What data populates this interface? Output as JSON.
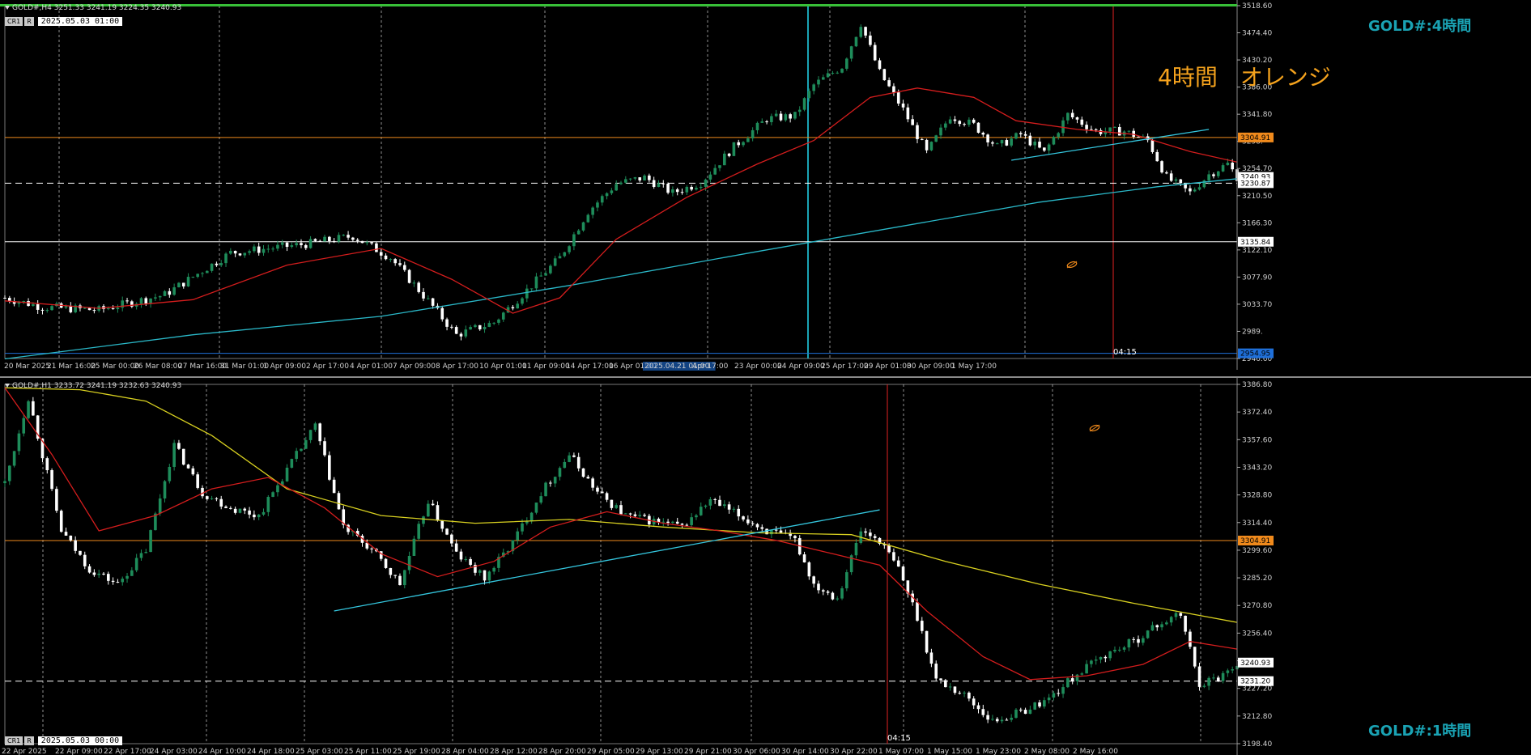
{
  "colors": {
    "bull": "#1e8c5a",
    "bear": "#ffffff",
    "ma_short": "#d41d1d",
    "ma_long_h4": "#2ab8c8",
    "ma_long_h1": "#d8d020",
    "resistance": "#f08a1c",
    "support": "#ffffff",
    "grid": "#cfcfcf",
    "trend": "#34c6de",
    "vline_red": "#e22222",
    "vline_cyan": "#1aa3b4",
    "bottom_blue": "#1f6fd8",
    "axis_text": "#d0d0d0"
  },
  "top_pane": {
    "header": "GOLD#,H4  3251.33 3241.19 3224.35 3240.93",
    "cr": "CR1",
    "r": "R",
    "datetime": "2025.05.03 01:00",
    "tf_label": "GOLD#:4時間",
    "note": "4時間　オレンジ",
    "time_tag": "04:15",
    "x_labels": [
      "20 Mar 2025",
      "21 Mar 16:00",
      "25 Mar 00:00",
      "26 Mar 08:00",
      "27 Mar 16:00",
      "31 Mar 01:00",
      "1 Apr 09:00",
      "2 Apr 17:00",
      "4 Apr 01:00",
      "7 Apr 09:00",
      "8 Apr 17:00",
      "10 Apr 01:00",
      "11 Apr 09:00",
      "14 Apr 17:00",
      "16 Apr 01:00",
      "2025.04.21 01:00",
      "Apr 17:00",
      "23 Apr 00:00",
      "24 Apr 09:00",
      "25 Apr 17:00",
      "29 Apr 01:00",
      "30 Apr 09:00",
      "1 May 17:00"
    ],
    "y_labels": [
      "3518.60",
      "3474.40",
      "3430.20",
      "3386.00",
      "3341.80",
      "3298.",
      "3254.70",
      "3210.50",
      "3166.30",
      "3122.10",
      "3077.90",
      "3033.70",
      "2989.",
      "2946.60"
    ],
    "price_tags": [
      {
        "text": "3304.91",
        "kind": "orange"
      },
      {
        "text": "3240.93",
        "kind": "white"
      },
      {
        "text": "3230.87",
        "kind": "white"
      },
      {
        "text": "3135.84",
        "kind": "white"
      },
      {
        "text": "2954.95",
        "kind": "blue"
      }
    ]
  },
  "bottom_pane": {
    "header": "GOLD#,H1  3233.72 3241.19 3232.63 3240.93",
    "cr": "CR1",
    "r": "R",
    "datetime": "2025.05.03 00:00",
    "tf_label": "GOLD#:1時間",
    "time_tag": "04:15",
    "x_labels": [
      "22 Apr 2025",
      "22 Apr 09:00",
      "22 Apr 17:00",
      "24 Apr 03:00",
      "24 Apr 10:00",
      "24 Apr 18:00",
      "25 Apr 03:00",
      "25 Apr 11:00",
      "25 Apr 19:00",
      "28 Apr 04:00",
      "28 Apr 12:00",
      "28 Apr 20:00",
      "29 Apr 05:00",
      "29 Apr 13:00",
      "29 Apr 21:00",
      "30 Apr 06:00",
      "30 Apr 14:00",
      "30 Apr 22:00",
      "1 May 07:00",
      "1 May 15:00",
      "1 May 23:00",
      "2 May 08:00",
      "2 May 16:00"
    ],
    "y_labels": [
      "3386.80",
      "3372.40",
      "3357.60",
      "3343.20",
      "3328.80",
      "3314.40",
      "3299.60",
      "3285.20",
      "3270.80",
      "3256.40",
      "3241.60",
      "3227.20",
      "3212.80",
      "3198.40"
    ],
    "price_tags": [
      {
        "text": "3304.91",
        "kind": "orange"
      },
      {
        "text": "3240.93",
        "kind": "white"
      },
      {
        "text": "3231.20",
        "kind": "white"
      }
    ]
  },
  "chart_data": [
    {
      "type": "candlestick",
      "symbol": "GOLD#",
      "timeframe": "H4",
      "title": "GOLD#:4時間",
      "ylim": [
        2946.6,
        3518.6
      ],
      "horizontal_levels": [
        {
          "price": 3304.91,
          "color": "orange"
        },
        {
          "price": 3230.87,
          "color": "white",
          "style": "dashed"
        },
        {
          "price": 3135.84,
          "color": "white"
        },
        {
          "price": 2954.95,
          "color": "blue"
        }
      ],
      "anchors": [
        {
          "idx": 0,
          "p": 3045
        },
        {
          "idx": 8,
          "p": 3030
        },
        {
          "idx": 20,
          "p": 3025
        },
        {
          "idx": 34,
          "p": 3050
        },
        {
          "idx": 48,
          "p": 3118
        },
        {
          "idx": 64,
          "p": 3132
        },
        {
          "idx": 74,
          "p": 3145
        },
        {
          "idx": 82,
          "p": 3110
        },
        {
          "idx": 90,
          "p": 3040
        },
        {
          "idx": 96,
          "p": 2985
        },
        {
          "idx": 104,
          "p": 3005
        },
        {
          "idx": 110,
          "p": 3050
        },
        {
          "idx": 118,
          "p": 3110
        },
        {
          "idx": 124,
          "p": 3185
        },
        {
          "idx": 130,
          "p": 3230
        },
        {
          "idx": 136,
          "p": 3240
        },
        {
          "idx": 142,
          "p": 3215
        },
        {
          "idx": 148,
          "p": 3232
        },
        {
          "idx": 155,
          "p": 3290
        },
        {
          "idx": 162,
          "p": 3335
        },
        {
          "idx": 168,
          "p": 3340
        },
        {
          "idx": 172,
          "p": 3390
        },
        {
          "idx": 178,
          "p": 3420
        },
        {
          "idx": 182,
          "p": 3490
        },
        {
          "idx": 186,
          "p": 3410
        },
        {
          "idx": 191,
          "p": 3350
        },
        {
          "idx": 196,
          "p": 3280
        },
        {
          "idx": 201,
          "p": 3340
        },
        {
          "idx": 206,
          "p": 3325
        },
        {
          "idx": 211,
          "p": 3290
        },
        {
          "idx": 216,
          "p": 3310
        },
        {
          "idx": 221,
          "p": 3280
        },
        {
          "idx": 226,
          "p": 3342
        },
        {
          "idx": 232,
          "p": 3315
        },
        {
          "idx": 238,
          "p": 3315
        },
        {
          "idx": 243,
          "p": 3300
        },
        {
          "idx": 247,
          "p": 3240
        },
        {
          "idx": 252,
          "p": 3215
        },
        {
          "idx": 256,
          "p": 3245
        },
        {
          "idx": 260,
          "p": 3262
        },
        {
          "idx": 262,
          "p": 3241
        }
      ],
      "ma_fast": [
        [
          0,
          3040
        ],
        [
          20,
          3028
        ],
        [
          40,
          3042
        ],
        [
          60,
          3098
        ],
        [
          80,
          3125
        ],
        [
          95,
          3075
        ],
        [
          108,
          3020
        ],
        [
          118,
          3045
        ],
        [
          130,
          3140
        ],
        [
          145,
          3208
        ],
        [
          160,
          3262
        ],
        [
          172,
          3300
        ],
        [
          184,
          3370
        ],
        [
          194,
          3385
        ],
        [
          206,
          3370
        ],
        [
          215,
          3332
        ],
        [
          228,
          3318
        ],
        [
          240,
          3310
        ],
        [
          252,
          3282
        ],
        [
          262,
          3265
        ]
      ],
      "ma_slow": [
        [
          0,
          2946
        ],
        [
          40,
          2985
        ],
        [
          80,
          3015
        ],
        [
          120,
          3065
        ],
        [
          160,
          3120
        ],
        [
          190,
          3160
        ],
        [
          220,
          3200
        ],
        [
          245,
          3225
        ],
        [
          262,
          3238
        ]
      ],
      "trendline": [
        [
          214,
          3268
        ],
        [
          256,
          3318
        ]
      ]
    },
    {
      "type": "candlestick",
      "symbol": "GOLD#",
      "timeframe": "H1",
      "title": "GOLD#:1時間",
      "ylim": [
        3198.4,
        3386.8
      ],
      "horizontal_levels": [
        {
          "price": 3304.91,
          "color": "orange"
        },
        {
          "price": 3231.2,
          "color": "white",
          "style": "dashed"
        }
      ],
      "anchors": [
        {
          "idx": 0,
          "p": 3335
        },
        {
          "idx": 5,
          "p": 3380
        },
        {
          "idx": 12,
          "p": 3310
        },
        {
          "idx": 18,
          "p": 3290
        },
        {
          "idx": 24,
          "p": 3282
        },
        {
          "idx": 30,
          "p": 3300
        },
        {
          "idx": 36,
          "p": 3355
        },
        {
          "idx": 42,
          "p": 3330
        },
        {
          "idx": 48,
          "p": 3322
        },
        {
          "idx": 54,
          "p": 3318
        },
        {
          "idx": 60,
          "p": 3342
        },
        {
          "idx": 66,
          "p": 3365
        },
        {
          "idx": 72,
          "p": 3312
        },
        {
          "idx": 78,
          "p": 3300
        },
        {
          "idx": 84,
          "p": 3282
        },
        {
          "idx": 90,
          "p": 3326
        },
        {
          "idx": 96,
          "p": 3298
        },
        {
          "idx": 102,
          "p": 3285
        },
        {
          "idx": 108,
          "p": 3304
        },
        {
          "idx": 114,
          "p": 3330
        },
        {
          "idx": 120,
          "p": 3350
        },
        {
          "idx": 126,
          "p": 3330
        },
        {
          "idx": 132,
          "p": 3318
        },
        {
          "idx": 138,
          "p": 3315
        },
        {
          "idx": 144,
          "p": 3312
        },
        {
          "idx": 150,
          "p": 3326
        },
        {
          "idx": 156,
          "p": 3318
        },
        {
          "idx": 162,
          "p": 3310
        },
        {
          "idx": 168,
          "p": 3305
        },
        {
          "idx": 172,
          "p": 3282
        },
        {
          "idx": 177,
          "p": 3275
        },
        {
          "idx": 182,
          "p": 3310
        },
        {
          "idx": 186,
          "p": 3305
        },
        {
          "idx": 190,
          "p": 3290
        },
        {
          "idx": 194,
          "p": 3265
        },
        {
          "idx": 198,
          "p": 3232
        },
        {
          "idx": 204,
          "p": 3224
        },
        {
          "idx": 210,
          "p": 3210
        },
        {
          "idx": 216,
          "p": 3215
        },
        {
          "idx": 222,
          "p": 3222
        },
        {
          "idx": 228,
          "p": 3235
        },
        {
          "idx": 234,
          "p": 3245
        },
        {
          "idx": 240,
          "p": 3252
        },
        {
          "idx": 246,
          "p": 3262
        },
        {
          "idx": 250,
          "p": 3266
        },
        {
          "idx": 254,
          "p": 3230
        },
        {
          "idx": 258,
          "p": 3233
        },
        {
          "idx": 262,
          "p": 3241
        }
      ],
      "ma_fast": [
        [
          0,
          3385
        ],
        [
          10,
          3350
        ],
        [
          20,
          3310
        ],
        [
          32,
          3318
        ],
        [
          44,
          3332
        ],
        [
          56,
          3338
        ],
        [
          68,
          3322
        ],
        [
          80,
          3298
        ],
        [
          92,
          3286
        ],
        [
          104,
          3294
        ],
        [
          116,
          3312
        ],
        [
          128,
          3320
        ],
        [
          140,
          3314
        ],
        [
          152,
          3310
        ],
        [
          164,
          3305
        ],
        [
          176,
          3298
        ],
        [
          186,
          3292
        ],
        [
          196,
          3268
        ],
        [
          208,
          3244
        ],
        [
          218,
          3232
        ],
        [
          230,
          3234
        ],
        [
          242,
          3240
        ],
        [
          252,
          3252
        ],
        [
          262,
          3248
        ]
      ],
      "ma_slow": [
        [
          0,
          3385
        ],
        [
          16,
          3384
        ],
        [
          30,
          3378
        ],
        [
          44,
          3360
        ],
        [
          60,
          3332
        ],
        [
          80,
          3318
        ],
        [
          100,
          3314
        ],
        [
          120,
          3316
        ],
        [
          140,
          3312
        ],
        [
          160,
          3309
        ],
        [
          180,
          3308
        ],
        [
          200,
          3294
        ],
        [
          220,
          3282
        ],
        [
          240,
          3272
        ],
        [
          262,
          3262
        ]
      ],
      "trendline": [
        [
          70,
          3268
        ],
        [
          186,
          3321
        ]
      ]
    }
  ]
}
